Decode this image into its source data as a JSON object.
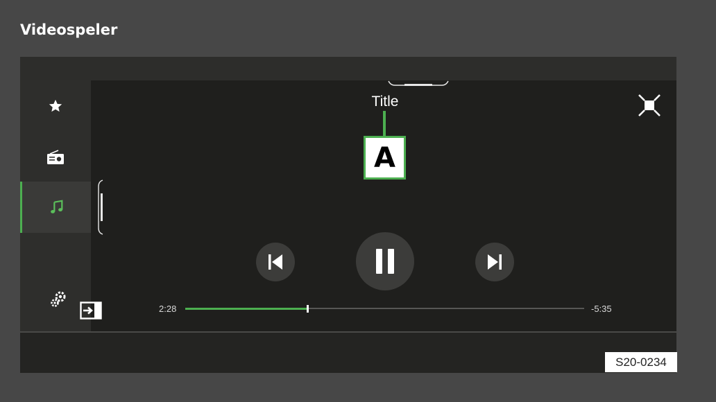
{
  "page": {
    "title": "Videospeler"
  },
  "sidebar": {
    "items": [
      {
        "icon": "star-icon",
        "active": false
      },
      {
        "icon": "radio-icon",
        "active": false
      },
      {
        "icon": "music-note-icon",
        "active": true
      }
    ],
    "settings_icon": "gear-icon"
  },
  "player": {
    "title": "Title",
    "callout": "A",
    "time_elapsed": "2:28",
    "time_remaining": "-5:35",
    "progress": 0.306
  },
  "controls": {
    "prev_icon": "skip-previous-icon",
    "pause_icon": "pause-icon",
    "next_icon": "skip-next-icon",
    "fullscreen_icon": "exit-fullscreen-icon",
    "source_icon": "source-select-icon"
  },
  "colors": {
    "accent": "#4caf50",
    "background": "#474747",
    "screen": "#1f1f1d"
  },
  "reference": "S20-0234"
}
